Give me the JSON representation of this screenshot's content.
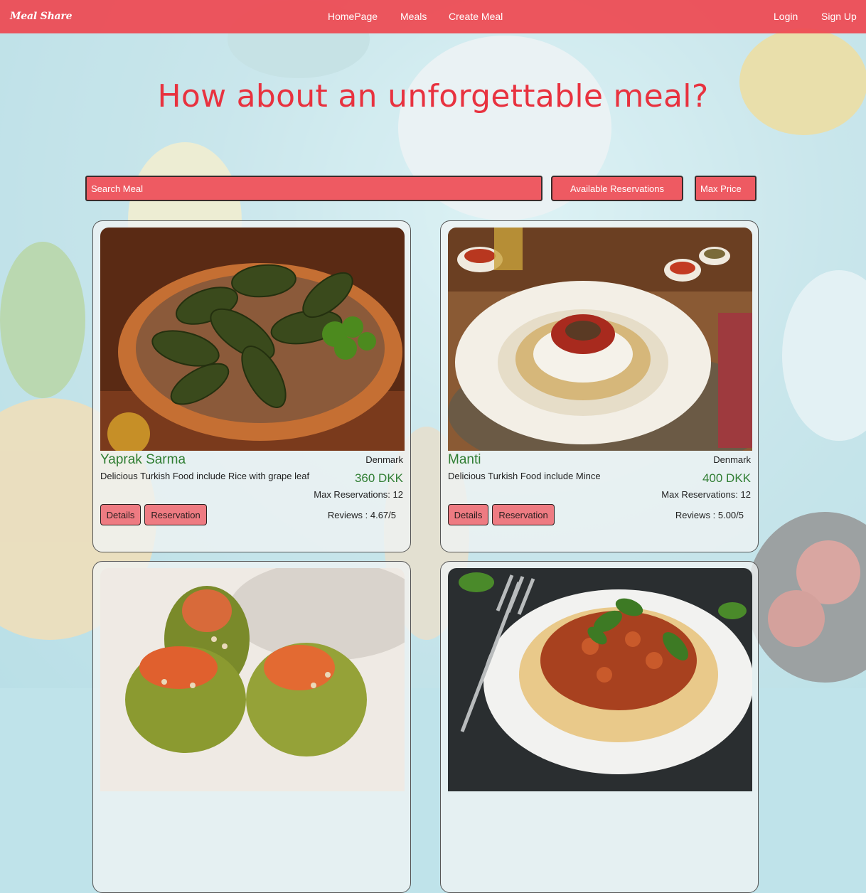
{
  "nav": {
    "logo": "Meal Share",
    "links": [
      "HomePage",
      "Meals",
      "Create Meal"
    ],
    "login": "Login",
    "signup": "Sign Up"
  },
  "hero": {
    "title": "How about an unforgettable meal?"
  },
  "search": {
    "placeholder": "Search Meal",
    "available_button": "Available Reservations",
    "max_price_placeholder": "Max Price"
  },
  "meals": [
    {
      "name": "Yaprak Sarma",
      "country": "Denmark",
      "description": "Delicious Turkish Food include Rice with grape leaf",
      "price": "360 DKK",
      "max_reservations": "Max Reservations: 12",
      "reviews": "Reviews : 4.67/5",
      "details_label": "Details",
      "reservation_label": "Reservation"
    },
    {
      "name": "Manti",
      "country": "Denmark",
      "description": "Delicious Turkish Food include Mince",
      "price": "400 DKK",
      "max_reservations": "Max Reservations: 12",
      "reviews": "Reviews : 5.00/5",
      "details_label": "Details",
      "reservation_label": "Reservation"
    },
    {
      "name": "",
      "country": ""
    },
    {
      "name": "",
      "country": ""
    }
  ],
  "colors": {
    "nav_bg": "#ee4850",
    "accent_red": "#e8323f",
    "button_red": "#ee5a62",
    "green_text": "#2f7d32"
  }
}
